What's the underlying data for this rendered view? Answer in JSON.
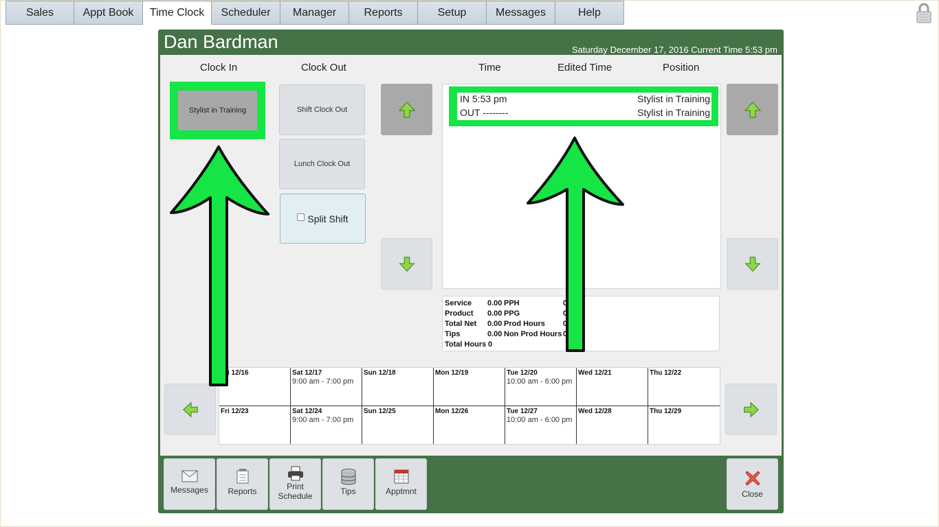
{
  "nav": {
    "tabs": [
      "Sales",
      "Appt Book",
      "Time Clock",
      "Scheduler",
      "Manager",
      "Reports",
      "Setup",
      "Messages",
      "Help"
    ],
    "active": "Time Clock"
  },
  "header": {
    "employee": "Dan Bardman",
    "datetime": "Saturday December 17, 2016 Current Time 5:53 pm"
  },
  "columns": {
    "clock_in": "Clock In",
    "clock_out": "Clock Out",
    "time": "Time",
    "edited_time": "Edited Time",
    "position": "Position"
  },
  "clock_in": {
    "position_button": "Stylist in Training"
  },
  "clock_out": {
    "shift_button": "Shift Clock Out",
    "lunch_button": "Lunch Clock Out",
    "split_shift": "Split Shift"
  },
  "entries": [
    {
      "time": "IN 5:53 pm",
      "position": "Stylist in Training"
    },
    {
      "time": "OUT --------",
      "position": "Stylist in Training"
    }
  ],
  "stats": {
    "service_label": "Service",
    "service": "0.00",
    "product_label": "Product",
    "product": "0.00",
    "total_net_label": "Total Net",
    "total_net": "0.00",
    "tips_label": "Tips",
    "tips": "0.00",
    "total_hours_label": "Total Hours",
    "total_hours": "0",
    "pph_label": "PPH",
    "pph": "0",
    "ppg_label": "PPG",
    "ppg": "0",
    "prod_hours_label": "Prod Hours",
    "prod_hours": "0",
    "non_prod_hours_label": "Non Prod Hours",
    "non_prod_hours": "0"
  },
  "schedule": [
    {
      "date": "Fri 12/16",
      "hours": ""
    },
    {
      "date": "Sat 12/17",
      "hours": "9:00 am - 7:00 pm"
    },
    {
      "date": "Sun 12/18",
      "hours": ""
    },
    {
      "date": "Mon 12/19",
      "hours": ""
    },
    {
      "date": "Tue 12/20",
      "hours": "10:00 am - 6:00 pm"
    },
    {
      "date": "Wed 12/21",
      "hours": ""
    },
    {
      "date": "Thu 12/22",
      "hours": ""
    },
    {
      "date": "Fri 12/23",
      "hours": ""
    },
    {
      "date": "Sat 12/24",
      "hours": "9:00 am - 7:00 pm"
    },
    {
      "date": "Sun 12/25",
      "hours": ""
    },
    {
      "date": "Mon 12/26",
      "hours": ""
    },
    {
      "date": "Tue 12/27",
      "hours": "10:00 am - 6:00 pm"
    },
    {
      "date": "Wed 12/28",
      "hours": ""
    },
    {
      "date": "Thu 12/29",
      "hours": ""
    }
  ],
  "toolbar": {
    "messages": "Messages",
    "reports": "Reports",
    "print_line1": "Print",
    "print_line2": "Schedule",
    "tips": "Tips",
    "apptmnt": "Apptmnt",
    "close": "Close"
  },
  "colors": {
    "panel_green": "#457247",
    "highlight_green": "#15e545",
    "arrow_green": "#6dbb3a"
  },
  "icons": [
    "lock-icon",
    "arrow-up-icon",
    "arrow-down-icon",
    "arrow-left-icon",
    "arrow-right-icon",
    "envelope-icon",
    "notepad-icon",
    "printer-icon",
    "database-icon",
    "calendar-icon",
    "close-x-icon"
  ]
}
